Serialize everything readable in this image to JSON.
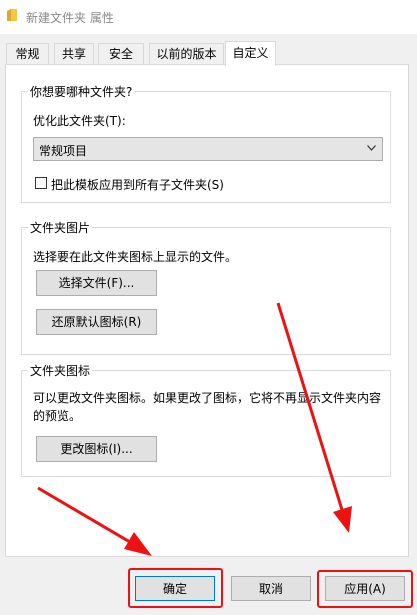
{
  "window": {
    "title": "新建文件夹 属性"
  },
  "tabs": [
    {
      "label": "常规"
    },
    {
      "label": "共享"
    },
    {
      "label": "安全"
    },
    {
      "label": "以前的版本"
    },
    {
      "label": "自定义"
    }
  ],
  "optimize_group": {
    "title": "你想要哪种文件夹?",
    "optimize_label": "优化此文件夹(T):",
    "select_value": "常规项目",
    "apply_checkbox_label": "把此模板应用到所有子文件夹(S)"
  },
  "picture_group": {
    "title": "文件夹图片",
    "description": "选择要在此文件夹图标上显示的文件。",
    "choose_file_label": "选择文件(F)...",
    "restore_default_label": "还原默认图标(R)"
  },
  "icon_group": {
    "title": "文件夹图标",
    "description_line1": "可以更改文件夹图标。如果更改了图标，它将不再显示文件夹内容",
    "description_line2": "的预览。",
    "change_icon_label": "更改图标(I)..."
  },
  "footer": {
    "ok_label": "确定",
    "cancel_label": "取消",
    "apply_label": "应用(A)"
  },
  "colors": {
    "annotation": "#ee1111",
    "accent": "#0078d7",
    "folder": "#f2c744"
  }
}
